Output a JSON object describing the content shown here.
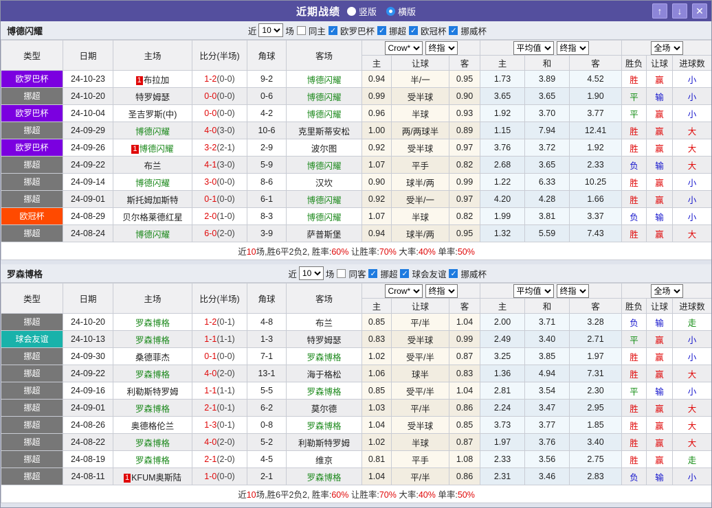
{
  "titlebar": {
    "title": "近期战绩",
    "radio_vertical": "竖版",
    "radio_horizontal": "横版",
    "selected_layout": "横版",
    "up_button": "↑",
    "down_button": "↓",
    "close_button": "✕"
  },
  "colors": {
    "titlebar_bg": "#544f9e",
    "type_badges": {
      "欧罗巴杯": "#7b00e0",
      "挪超": "#777777",
      "欧冠杯": "#ff4a00",
      "球会友谊": "#19b2aa"
    },
    "team_highlight": "#1e8a1e",
    "score_red": "#e00808",
    "result": {
      "胜": "#e00808",
      "平": "#0f8a0f",
      "负": "#1414cc",
      "赢": "#e00808",
      "输": "#1414cc",
      "大": "#e00808",
      "小": "#1414cc",
      "走": "#0f8a0f"
    }
  },
  "columns": {
    "main": [
      "类型",
      "日期",
      "主场",
      "比分(半场)",
      "角球",
      "客场"
    ],
    "sub": [
      "主",
      "让球",
      "客",
      "主",
      "和",
      "客",
      "胜负",
      "让球",
      "进球数"
    ],
    "widths": [
      90,
      73,
      115,
      80,
      57,
      110,
      43,
      84,
      45,
      65,
      65,
      76,
      36,
      38,
      57
    ]
  },
  "sections": [
    {
      "team": "博德闪耀",
      "filter": {
        "near_label": "近",
        "count": "10",
        "count_suffix": "场",
        "same_label": "同主",
        "same_checked": false,
        "leagues": [
          {
            "label": "欧罗巴杯",
            "checked": true
          },
          {
            "label": "挪超",
            "checked": true
          },
          {
            "label": "欧冠杯",
            "checked": true
          },
          {
            "label": "挪威杯",
            "checked": true
          }
        ]
      },
      "selects": {
        "odds_source": "Crow*",
        "odds_final": "终指",
        "average": "平均值",
        "average_final": "终指",
        "fulltime": "全场"
      },
      "rows": [
        {
          "type": "欧罗巴杯",
          "date": "24-10-23",
          "home": "布拉加",
          "home_badge": "1",
          "home_green": false,
          "score": "1-2",
          "half": "(0-0)",
          "corner": "9-2",
          "away": "博德闪耀",
          "away_green": true,
          "odds": [
            "0.94",
            "半/一",
            "0.95"
          ],
          "avg": [
            "1.73",
            "3.89",
            "4.52"
          ],
          "result": [
            "胜",
            "赢",
            "小"
          ]
        },
        {
          "type": "挪超",
          "date": "24-10-20",
          "home": "特罗姆瑟",
          "home_green": false,
          "score": "0-0",
          "half": "(0-0)",
          "corner": "0-6",
          "away": "博德闪耀",
          "away_green": true,
          "odds": [
            "0.99",
            "受半球",
            "0.90"
          ],
          "avg": [
            "3.65",
            "3.65",
            "1.90"
          ],
          "result": [
            "平",
            "输",
            "小"
          ]
        },
        {
          "type": "欧罗巴杯",
          "date": "24-10-04",
          "home": "圣吉罗斯(中)",
          "home_green": false,
          "score": "0-0",
          "half": "(0-0)",
          "corner": "4-2",
          "away": "博德闪耀",
          "away_green": true,
          "odds": [
            "0.96",
            "半球",
            "0.93"
          ],
          "avg": [
            "1.92",
            "3.70",
            "3.77"
          ],
          "result": [
            "平",
            "赢",
            "小"
          ]
        },
        {
          "type": "挪超",
          "date": "24-09-29",
          "home": "博德闪耀",
          "home_green": true,
          "score": "4-0",
          "half": "(3-0)",
          "corner": "10-6",
          "away": "克里斯蒂安松",
          "away_green": false,
          "odds": [
            "1.00",
            "两/两球半",
            "0.89"
          ],
          "avg": [
            "1.15",
            "7.94",
            "12.41"
          ],
          "result": [
            "胜",
            "赢",
            "大"
          ]
        },
        {
          "type": "欧罗巴杯",
          "date": "24-09-26",
          "home": "博德闪耀",
          "home_badge": "1",
          "home_green": true,
          "score": "3-2",
          "half": "(2-1)",
          "corner": "2-9",
          "away": "波尔图",
          "away_green": false,
          "odds": [
            "0.92",
            "受半球",
            "0.97"
          ],
          "avg": [
            "3.76",
            "3.72",
            "1.92"
          ],
          "result": [
            "胜",
            "赢",
            "大"
          ]
        },
        {
          "type": "挪超",
          "date": "24-09-22",
          "home": "布兰",
          "home_green": false,
          "score": "4-1",
          "half": "(3-0)",
          "corner": "5-9",
          "away": "博德闪耀",
          "away_green": true,
          "odds": [
            "1.07",
            "平手",
            "0.82"
          ],
          "avg": [
            "2.68",
            "3.65",
            "2.33"
          ],
          "result": [
            "负",
            "输",
            "大"
          ]
        },
        {
          "type": "挪超",
          "date": "24-09-14",
          "home": "博德闪耀",
          "home_green": true,
          "score": "3-0",
          "half": "(0-0)",
          "corner": "8-6",
          "away": "汉坎",
          "away_green": false,
          "odds": [
            "0.90",
            "球半/两",
            "0.99"
          ],
          "avg": [
            "1.22",
            "6.33",
            "10.25"
          ],
          "result": [
            "胜",
            "赢",
            "小"
          ]
        },
        {
          "type": "挪超",
          "date": "24-09-01",
          "home": "斯托姆加斯特",
          "home_green": false,
          "score": "0-1",
          "half": "(0-0)",
          "corner": "6-1",
          "away": "博德闪耀",
          "away_green": true,
          "odds": [
            "0.92",
            "受半/一",
            "0.97"
          ],
          "avg": [
            "4.20",
            "4.28",
            "1.66"
          ],
          "result": [
            "胜",
            "赢",
            "小"
          ]
        },
        {
          "type": "欧冠杯",
          "date": "24-08-29",
          "home": "贝尔格莱德红星",
          "home_green": false,
          "score": "2-0",
          "half": "(1-0)",
          "corner": "8-3",
          "away": "博德闪耀",
          "away_green": true,
          "odds": [
            "1.07",
            "半球",
            "0.82"
          ],
          "avg": [
            "1.99",
            "3.81",
            "3.37"
          ],
          "result": [
            "负",
            "输",
            "小"
          ]
        },
        {
          "type": "挪超",
          "date": "24-08-24",
          "home": "博德闪耀",
          "home_green": true,
          "score": "6-0",
          "half": "(2-0)",
          "corner": "3-9",
          "away": "萨普斯堡",
          "away_green": false,
          "odds": [
            "0.94",
            "球半/两",
            "0.95"
          ],
          "avg": [
            "1.32",
            "5.59",
            "7.43"
          ],
          "result": [
            "胜",
            "赢",
            "大"
          ]
        }
      ],
      "summary": [
        {
          "text": "近",
          "red": false
        },
        {
          "text": "10",
          "red": true
        },
        {
          "text": "场,胜6平2负2, 胜率:",
          "red": false
        },
        {
          "text": "60%",
          "red": true
        },
        {
          "text": " 让胜率:",
          "red": false
        },
        {
          "text": "70%",
          "red": true
        },
        {
          "text": " 大率:",
          "red": false
        },
        {
          "text": "40%",
          "red": true
        },
        {
          "text": " 单率:",
          "red": false
        },
        {
          "text": "50%",
          "red": true
        }
      ]
    },
    {
      "team": "罗森博格",
      "filter": {
        "near_label": "近",
        "count": "10",
        "count_suffix": "场",
        "same_label": "同客",
        "same_checked": false,
        "leagues": [
          {
            "label": "挪超",
            "checked": true
          },
          {
            "label": "球会友谊",
            "checked": true
          },
          {
            "label": "挪威杯",
            "checked": true
          }
        ]
      },
      "selects": {
        "odds_source": "Crow*",
        "odds_final": "终指",
        "average": "平均值",
        "average_final": "终指",
        "fulltime": "全场"
      },
      "rows": [
        {
          "type": "挪超",
          "date": "24-10-20",
          "home": "罗森博格",
          "home_green": true,
          "score": "1-2",
          "half": "(0-1)",
          "corner": "4-8",
          "away": "布兰",
          "away_green": false,
          "odds": [
            "0.85",
            "平/半",
            "1.04"
          ],
          "avg": [
            "2.00",
            "3.71",
            "3.28"
          ],
          "result": [
            "负",
            "输",
            "走"
          ]
        },
        {
          "type": "球会友谊",
          "date": "24-10-13",
          "home": "罗森博格",
          "home_green": true,
          "score": "1-1",
          "half": "(1-1)",
          "corner": "1-3",
          "away": "特罗姆瑟",
          "away_green": false,
          "odds": [
            "0.83",
            "受半球",
            "0.99"
          ],
          "avg": [
            "2.49",
            "3.40",
            "2.71"
          ],
          "result": [
            "平",
            "赢",
            "小"
          ]
        },
        {
          "type": "挪超",
          "date": "24-09-30",
          "home": "桑德菲杰",
          "home_green": false,
          "score": "0-1",
          "half": "(0-0)",
          "corner": "7-1",
          "away": "罗森博格",
          "away_green": true,
          "odds": [
            "1.02",
            "受平/半",
            "0.87"
          ],
          "avg": [
            "3.25",
            "3.85",
            "1.97"
          ],
          "result": [
            "胜",
            "赢",
            "小"
          ]
        },
        {
          "type": "挪超",
          "date": "24-09-22",
          "home": "罗森博格",
          "home_green": true,
          "score": "4-0",
          "half": "(2-0)",
          "corner": "13-1",
          "away": "海于格松",
          "away_green": false,
          "odds": [
            "1.06",
            "球半",
            "0.83"
          ],
          "avg": [
            "1.36",
            "4.94",
            "7.31"
          ],
          "result": [
            "胜",
            "赢",
            "大"
          ]
        },
        {
          "type": "挪超",
          "date": "24-09-16",
          "home": "利勒斯特罗姆",
          "home_green": false,
          "score": "1-1",
          "half": "(1-1)",
          "corner": "5-5",
          "away": "罗森博格",
          "away_green": true,
          "odds": [
            "0.85",
            "受平/半",
            "1.04"
          ],
          "avg": [
            "2.81",
            "3.54",
            "2.30"
          ],
          "result": [
            "平",
            "输",
            "小"
          ]
        },
        {
          "type": "挪超",
          "date": "24-09-01",
          "home": "罗森博格",
          "home_green": true,
          "score": "2-1",
          "half": "(0-1)",
          "corner": "6-2",
          "away": "莫尔德",
          "away_green": false,
          "odds": [
            "1.03",
            "平/半",
            "0.86"
          ],
          "avg": [
            "2.24",
            "3.47",
            "2.95"
          ],
          "result": [
            "胜",
            "赢",
            "大"
          ]
        },
        {
          "type": "挪超",
          "date": "24-08-26",
          "home": "奥德格伦兰",
          "home_green": false,
          "score": "1-3",
          "half": "(0-1)",
          "corner": "0-8",
          "away": "罗森博格",
          "away_green": true,
          "odds": [
            "1.04",
            "受半球",
            "0.85"
          ],
          "avg": [
            "3.73",
            "3.77",
            "1.85"
          ],
          "result": [
            "胜",
            "赢",
            "大"
          ]
        },
        {
          "type": "挪超",
          "date": "24-08-22",
          "home": "罗森博格",
          "home_green": true,
          "score": "4-0",
          "half": "(2-0)",
          "corner": "5-2",
          "away": "利勒斯特罗姆",
          "away_green": false,
          "odds": [
            "1.02",
            "半球",
            "0.87"
          ],
          "avg": [
            "1.97",
            "3.76",
            "3.40"
          ],
          "result": [
            "胜",
            "赢",
            "大"
          ]
        },
        {
          "type": "挪超",
          "date": "24-08-19",
          "home": "罗森博格",
          "home_green": true,
          "score": "2-1",
          "half": "(2-0)",
          "corner": "4-5",
          "away": "维京",
          "away_green": false,
          "odds": [
            "0.81",
            "平手",
            "1.08"
          ],
          "avg": [
            "2.33",
            "3.56",
            "2.75"
          ],
          "result": [
            "胜",
            "赢",
            "走"
          ]
        },
        {
          "type": "挪超",
          "date": "24-08-11",
          "home": "KFUM奥斯陆",
          "home_badge": "1",
          "home_green": false,
          "score": "1-0",
          "half": "(0-0)",
          "corner": "2-1",
          "away": "罗森博格",
          "away_green": true,
          "odds": [
            "1.04",
            "平/半",
            "0.86"
          ],
          "avg": [
            "2.31",
            "3.46",
            "2.83"
          ],
          "result": [
            "负",
            "输",
            "小"
          ]
        }
      ],
      "summary": [
        {
          "text": "近",
          "red": false
        },
        {
          "text": "10",
          "red": true
        },
        {
          "text": "场,胜6平2负2, 胜率:",
          "red": false
        },
        {
          "text": "60%",
          "red": true
        },
        {
          "text": " 让胜率:",
          "red": false
        },
        {
          "text": "70%",
          "red": true
        },
        {
          "text": " 大率:",
          "red": false
        },
        {
          "text": "40%",
          "red": true
        },
        {
          "text": " 单率:",
          "red": false
        },
        {
          "text": "50%",
          "red": true
        }
      ]
    }
  ]
}
